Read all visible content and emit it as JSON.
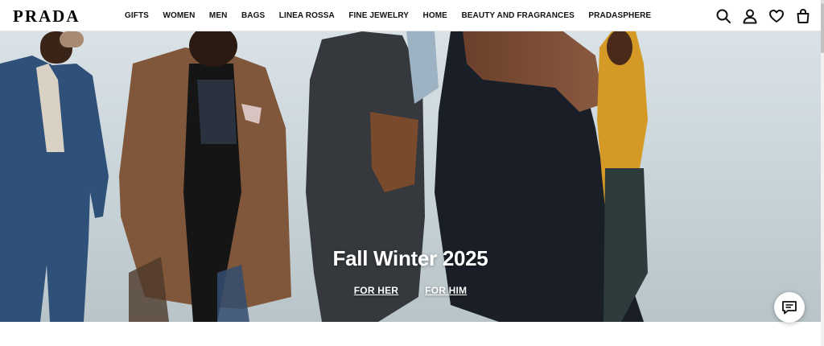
{
  "brand": {
    "logo_text": "PRADA"
  },
  "nav": {
    "items": [
      {
        "label": "GIFTS"
      },
      {
        "label": "WOMEN"
      },
      {
        "label": "MEN"
      },
      {
        "label": "BAGS"
      },
      {
        "label": "LINEA ROSSA"
      },
      {
        "label": "FINE JEWELRY"
      },
      {
        "label": "HOME"
      },
      {
        "label": "BEAUTY AND FRAGRANCES"
      },
      {
        "label": "PRADASPHERE"
      }
    ]
  },
  "header_icons": [
    "search-icon",
    "account-icon",
    "wishlist-heart-icon",
    "shopping-bag-icon"
  ],
  "hero": {
    "title": "Fall Winter 2025",
    "links": [
      {
        "label": "FOR HER"
      },
      {
        "label": "FOR HIM"
      }
    ]
  },
  "chat": {
    "icon": "chat-icon"
  },
  "colors": {
    "text": "#111111",
    "hero_bg": "#cfd9de",
    "white": "#ffffff"
  }
}
